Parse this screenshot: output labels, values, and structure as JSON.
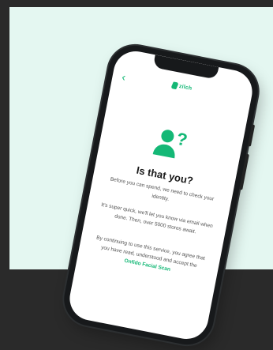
{
  "app": {
    "brand_name": "zilch",
    "back_icon": "chevron-left-icon",
    "accent_color": "#14b876"
  },
  "screen": {
    "illustration_icon": "person-question-icon",
    "title": "Is that you?",
    "paragraph_1": "Before you can spend, we need to check your identity.",
    "paragraph_2": "It's super quick, we'll let you know via email when done. Then, over 5000 stores await.",
    "paragraph_3_prefix": "By continuing to use this service, you agree that you have read, understood and accept the",
    "paragraph_3_link": "Onfido Facial Scan"
  }
}
